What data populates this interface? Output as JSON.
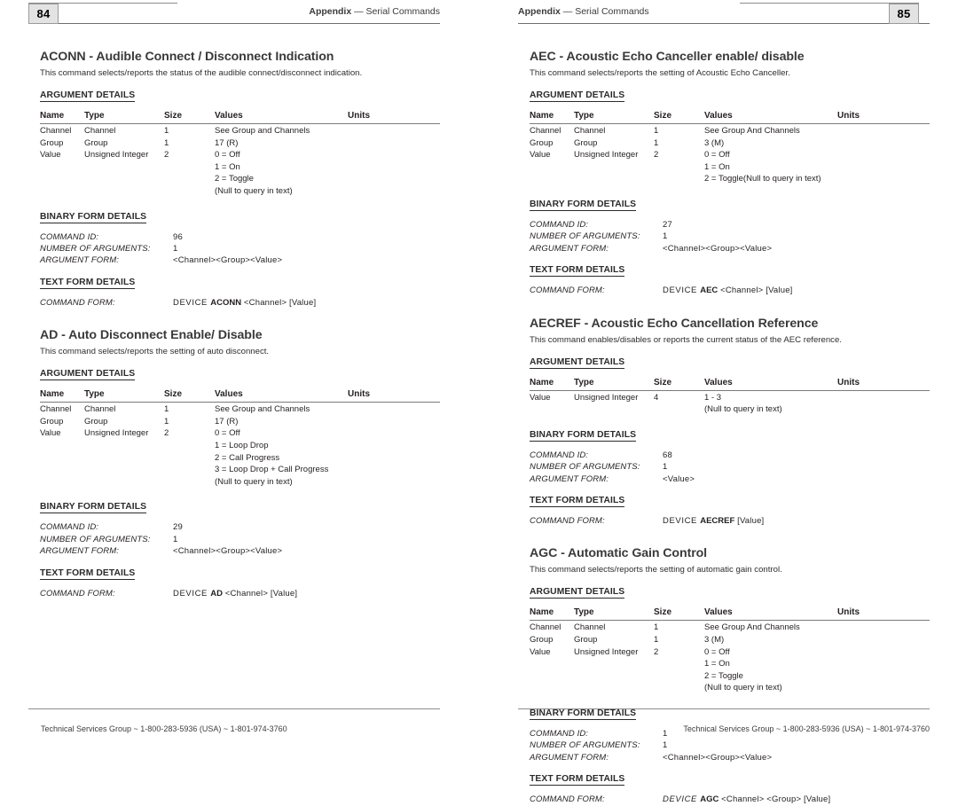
{
  "labels": {
    "argument_details": "ARGUMENT DETAILS",
    "binary_form_details": "BINARY FORM DETAILS",
    "text_form_details": "TEXT FORM DETAILS",
    "command_id": "COMMAND ID:",
    "number_of_arguments": "NUMBER OF ARGUMENTS:",
    "argument_form": "ARGUMENT FORM:",
    "command_form": "COMMAND FORM:",
    "columns": {
      "name": "Name",
      "type": "Type",
      "size": "Size",
      "values": "Values",
      "units": "Units"
    }
  },
  "pages": [
    {
      "number": "84",
      "running_head_prefix": "Appendix",
      "running_head_dash": "—",
      "running_head_suffix": "Serial Commands",
      "footer": "Technical Services Group ~ 1-800-283-5936 (USA) ~ 1-801-974-3760",
      "sections": [
        {
          "title": "ACONN - Audible Connect / Disconnect Indication",
          "description": "This command selects/reports the status of the audible connect/disconnect indication.",
          "rows": [
            {
              "name": "Channel",
              "type": "Channel",
              "size": "1",
              "values": "See Group and Channels",
              "units": ""
            },
            {
              "name": "Group",
              "type": "Group",
              "size": "1",
              "values": "17 (R)",
              "units": ""
            },
            {
              "name": "Value",
              "type": "Unsigned Integer",
              "size": "2",
              "values": "0 = Off",
              "units": ""
            }
          ],
          "continuation_values": [
            "1 = On",
            "2 = Toggle",
            "(Null to query in text)"
          ],
          "binary": {
            "command_id": "96",
            "number_of_arguments": "1",
            "argument_form": "<Channel><Group><Value>"
          },
          "text_form": {
            "device_word": "DEVICE",
            "device_italic": false,
            "command": "ACONN",
            "args": "<Channel> [Value]"
          }
        },
        {
          "title": "AD - Auto Disconnect Enable/ Disable",
          "description": "This command selects/reports the setting of auto disconnect.",
          "rows": [
            {
              "name": "Channel",
              "type": "Channel",
              "size": "1",
              "values": "See Group and Channels",
              "units": ""
            },
            {
              "name": "Group",
              "type": "Group",
              "size": "1",
              "values": "17 (R)",
              "units": ""
            },
            {
              "name": "Value",
              "type": "Unsigned Integer",
              "size": "2",
              "values": "0 = Off",
              "units": ""
            }
          ],
          "continuation_values": [
            "1 = Loop Drop",
            "2 = Call Progress",
            "3 = Loop Drop + Call Progress",
            "(Null to query in text)"
          ],
          "binary": {
            "command_id": "29",
            "number_of_arguments": "1",
            "argument_form": "<Channel><Group><Value>"
          },
          "text_form": {
            "device_word": "DEVICE",
            "device_italic": false,
            "command": "AD",
            "args": "<Channel> [Value]"
          }
        }
      ]
    },
    {
      "number": "85",
      "running_head_prefix": "Appendix",
      "running_head_dash": "—",
      "running_head_suffix": "Serial Commands",
      "footer": "Technical Services Group ~ 1-800-283-5936 (USA) ~ 1-801-974-3760",
      "sections": [
        {
          "title": "AEC - Acoustic Echo Canceller enable/ disable",
          "description": "This command selects/reports the setting of Acoustic Echo Canceller.",
          "rows": [
            {
              "name": "Channel",
              "type": "Channel",
              "size": "1",
              "values": "See Group And Channels",
              "units": ""
            },
            {
              "name": "Group",
              "type": "Group",
              "size": "1",
              "values": "3 (M)",
              "units": ""
            },
            {
              "name": "Value",
              "type": "Unsigned Integer",
              "size": "2",
              "values": "0 = Off",
              "units": ""
            }
          ],
          "continuation_values": [
            "1 = On",
            "2 = Toggle(Null to query in text)"
          ],
          "binary": {
            "command_id": "27",
            "number_of_arguments": "1",
            "argument_form": "<Channel><Group><Value>"
          },
          "text_form": {
            "device_word": "DEVICE",
            "device_italic": false,
            "command": "AEC",
            "args": "<Channel> [Value]"
          }
        },
        {
          "title": "AECREF - Acoustic Echo Cancellation Reference",
          "description": "This command enables/disables or reports the current status of the AEC reference.",
          "rows": [
            {
              "name": "Value",
              "type": "Unsigned Integer",
              "size": "4",
              "values": "1 - 3",
              "units": ""
            }
          ],
          "continuation_values": [
            "(Null to query in text)"
          ],
          "binary": {
            "command_id": "68",
            "number_of_arguments": "1",
            "argument_form": "<Value>"
          },
          "text_form": {
            "device_word": "DEVICE",
            "device_italic": false,
            "command": "AECREF",
            "args": "[Value]"
          }
        },
        {
          "title": "AGC - Automatic Gain Control",
          "description": "This command selects/reports the setting of automatic gain control.",
          "rows": [
            {
              "name": "Channel",
              "type": "Channel",
              "size": "1",
              "values": "See Group And Channels",
              "units": ""
            },
            {
              "name": "Group",
              "type": "Group",
              "size": "1",
              "values": "3 (M)",
              "units": ""
            },
            {
              "name": "Value",
              "type": "Unsigned Integer",
              "size": "2",
              "values": "0 = Off",
              "units": ""
            }
          ],
          "continuation_values": [
            "1 = On",
            "2 = Toggle",
            "(Null to query in text)"
          ],
          "binary": {
            "command_id": "1",
            "number_of_arguments": "1",
            "argument_form": "<Channel><Group><Value>"
          },
          "text_form": {
            "device_word": "DEVICE",
            "device_italic": true,
            "command": "AGC",
            "args": "<Channel> <Group> [Value]"
          }
        }
      ]
    }
  ]
}
